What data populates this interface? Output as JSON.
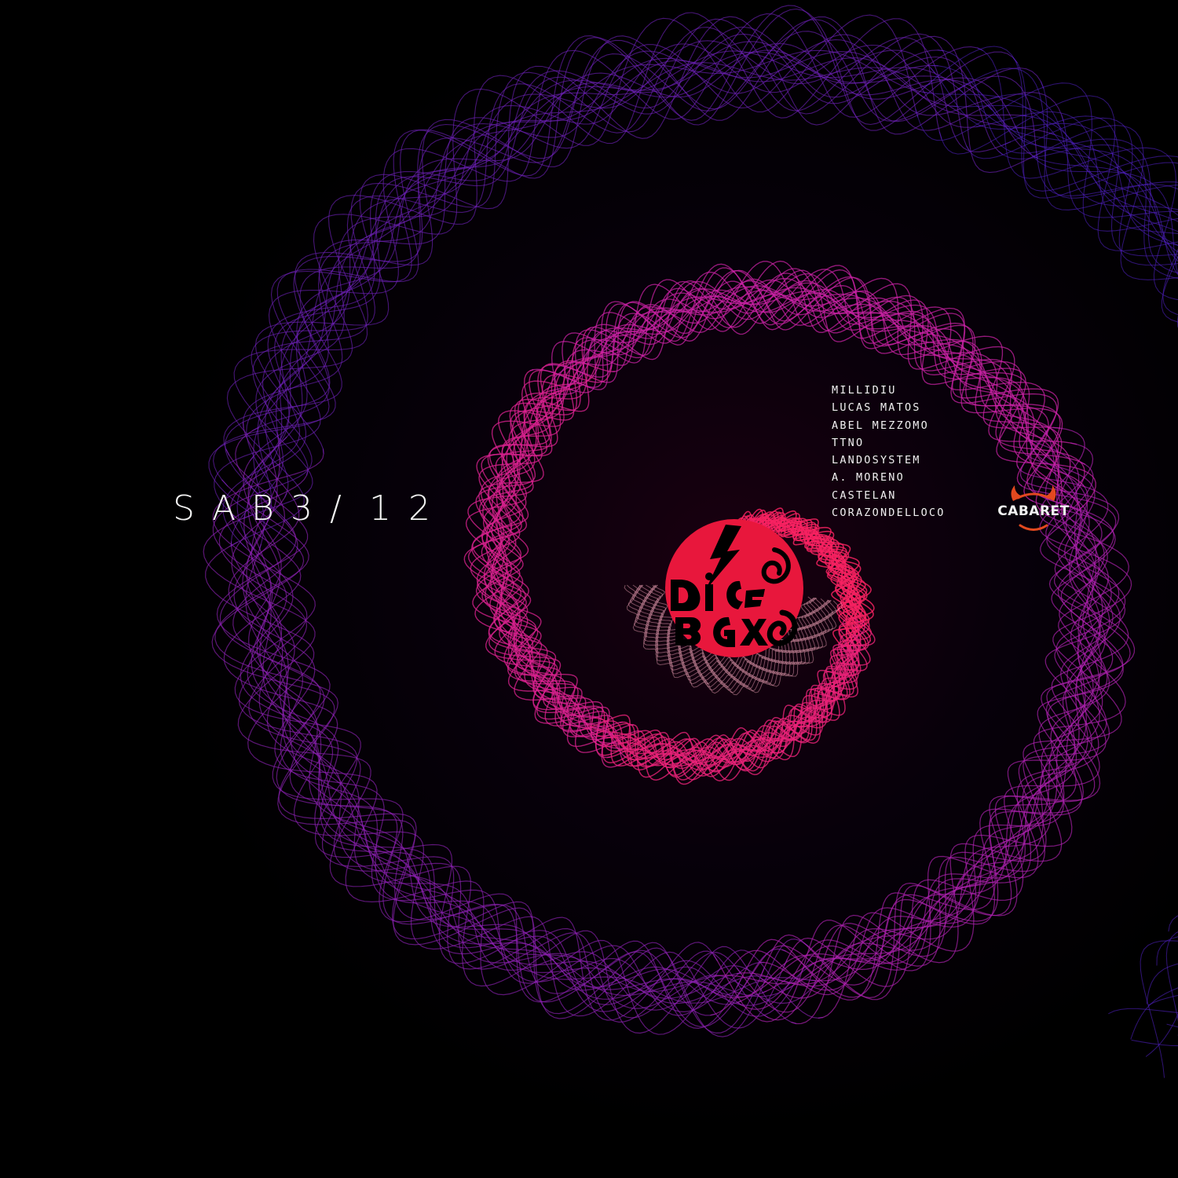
{
  "event": {
    "date_chars": [
      "S",
      "A",
      "B",
      "3",
      "/",
      "1",
      "2"
    ]
  },
  "lineup": [
    "MILLIDIU",
    "LUCAS MATOS",
    "ABEL MEZZOMO",
    "TTNO",
    "LANDOSYSTEM",
    "A. MORENO",
    "CASTELAN",
    "CORAZONDELLOCO"
  ],
  "venue": {
    "name": "CABARET",
    "icon": "devil-horns-icon",
    "accent_color": "#e2491f"
  },
  "party_logo": {
    "icon": "lightning-bolt-icon",
    "badge_color": "#e8173c"
  },
  "colors": {
    "background": "#000000",
    "spiral_inner": "#ff2255",
    "spiral_mid": "#cc22aa",
    "spiral_outer": "#4422cc",
    "text": "#f2f2f2"
  }
}
